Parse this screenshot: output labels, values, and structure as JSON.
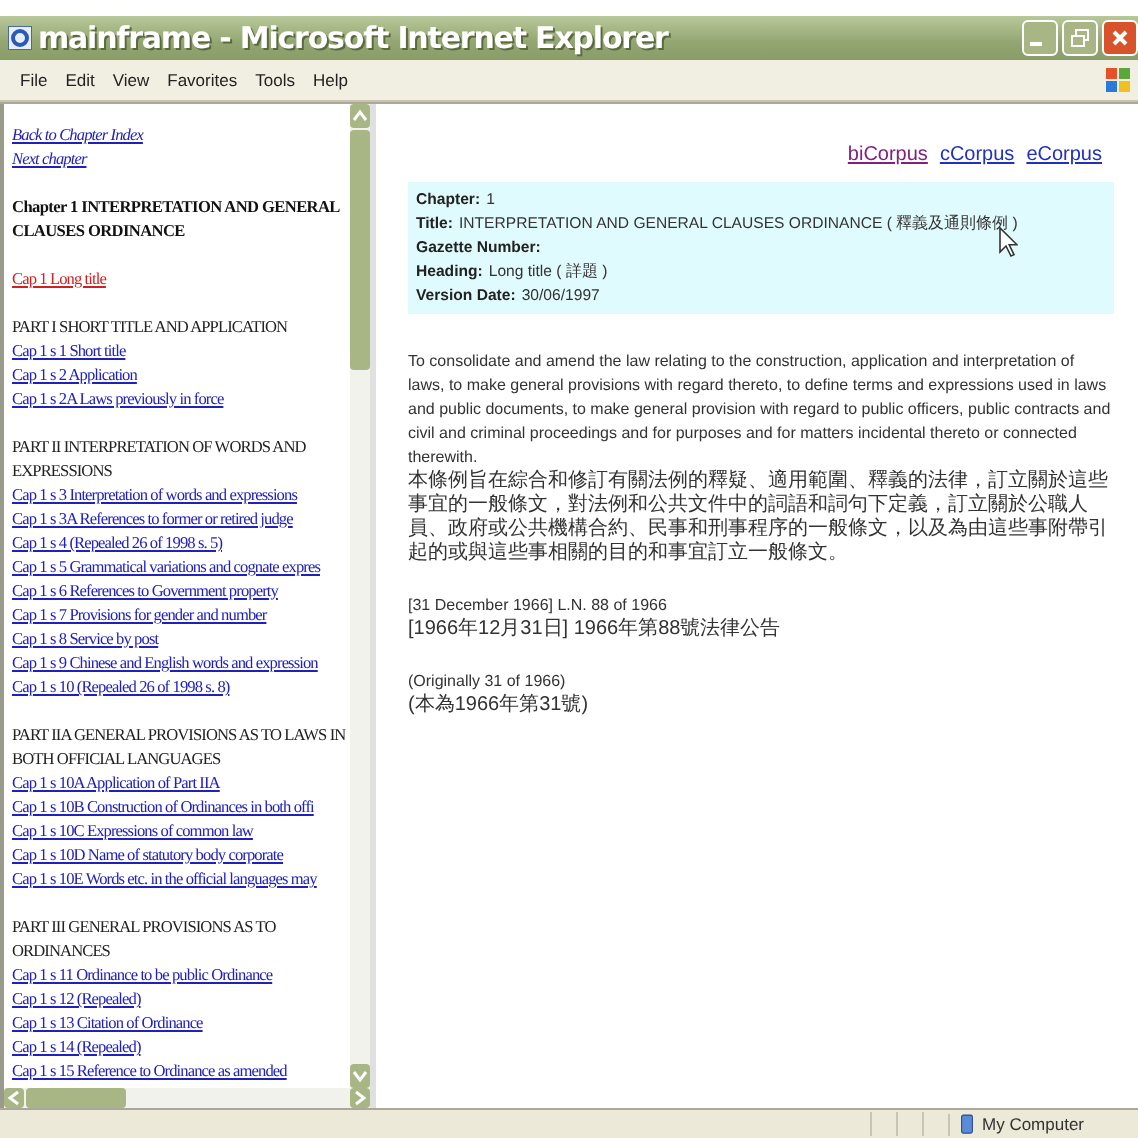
{
  "window": {
    "title": "mainframe - Microsoft Internet Explorer"
  },
  "menu": [
    "File",
    "Edit",
    "View",
    "Favorites",
    "Tools",
    "Help"
  ],
  "left_frame": {
    "nav_links": [
      "Back to Chapter Index",
      "Next chapter"
    ],
    "chapter_title": "Chapter 1 INTERPRETATION AND GENERAL CLAUSES ORDINANCE",
    "sections": [
      {
        "links": [
          {
            "text": "Cap 1 Long title",
            "selected": true
          }
        ]
      },
      {
        "heading": "PART I SHORT TITLE AND APPLICATION",
        "links": [
          {
            "text": "Cap 1 s 1 Short title",
            "selected": false
          },
          {
            "text": "Cap 1 s 2 Application",
            "selected": false
          },
          {
            "text": "Cap 1 s 2A Laws previously in force",
            "selected": false
          }
        ]
      },
      {
        "heading": "PART II INTERPRETATION OF WORDS AND EXPRESSIONS",
        "links": [
          {
            "text": "Cap 1 s 3 Interpretation of words and expressions",
            "selected": false
          },
          {
            "text": "Cap 1 s 3A References to former or retired judge",
            "selected": false
          },
          {
            "text": "Cap 1 s 4 (Repealed 26 of 1998 s. 5)",
            "selected": false
          },
          {
            "text": "Cap 1 s 5 Grammatical variations and cognate expres",
            "selected": false
          },
          {
            "text": "Cap 1 s 6 References to Government property",
            "selected": false
          },
          {
            "text": "Cap 1 s 7 Provisions for gender and number",
            "selected": false
          },
          {
            "text": "Cap 1 s 8 Service by post",
            "selected": false
          },
          {
            "text": "Cap 1 s 9 Chinese and English words and expression",
            "selected": false
          },
          {
            "text": "Cap 1 s 10 (Repealed 26 of 1998 s. 8)",
            "selected": false
          }
        ]
      },
      {
        "heading": "PART IIA GENERAL PROVISIONS AS TO LAWS IN BOTH OFFICIAL LANGUAGES",
        "links": [
          {
            "text": "Cap 1 s 10A Application of Part IIA",
            "selected": false
          },
          {
            "text": "Cap 1 s 10B Construction of Ordinances in both offi",
            "selected": false
          },
          {
            "text": "Cap 1 s 10C Expressions of common law",
            "selected": false
          },
          {
            "text": "Cap 1 s 10D Name of statutory body corporate",
            "selected": false
          },
          {
            "text": "Cap 1 s 10E Words etc. in the official languages may",
            "selected": false
          }
        ]
      },
      {
        "heading": "PART III GENERAL PROVISIONS AS TO ORDINANCES",
        "links": [
          {
            "text": "Cap 1 s 11 Ordinance to be public Ordinance",
            "selected": false
          },
          {
            "text": "Cap 1 s 12 (Repealed)",
            "selected": false
          },
          {
            "text": "Cap 1 s 13 Citation of Ordinance",
            "selected": false
          },
          {
            "text": "Cap 1 s 14 (Repealed)",
            "selected": false
          },
          {
            "text": "Cap 1 s 15 Reference to Ordinance as amended",
            "selected": false
          }
        ]
      }
    ]
  },
  "corpus_links": [
    {
      "text": "biCorpus",
      "visited": true
    },
    {
      "text": "cCorpus",
      "visited": false
    },
    {
      "text": "eCorpus",
      "visited": false
    }
  ],
  "info": [
    {
      "label": "Chapter:",
      "value": "1"
    },
    {
      "label": "Title:",
      "value": "INTERPRETATION AND GENERAL CLAUSES ORDINANCE ( 釋義及通則條例 )"
    },
    {
      "label": "Gazette Number:"
    },
    {
      "label": "Heading:",
      "value": "Long title ( 詳題 )"
    },
    {
      "label": "Version Date:",
      "value": "30/06/1997"
    }
  ],
  "body": [
    [
      "To consolidate and amend the law relating to the construction, application and interpretation of laws, to make general provisions with regard thereto, to define terms and expressions used in laws and public documents, to make general provision with regard to public officers, public contracts and civil and criminal proceedings and for purposes and for matters incidental thereto or connected therewith.",
      "本條例旨在綜合和修訂有關法例的釋疑、適用範圍、釋義的法律，訂立關於這些事宜的一般條文，對法例和公共文件中的詞語和詞句下定義，訂立關於公職人員、政府或公共機構合約、民事和刑事程序的一般條文，以及為由這些事附帶引起的或與這些事相關的目的和事宜訂立一般條文。"
    ],
    [
      "[31 December 1966] L.N. 88 of 1966",
      "[1966年12月31日] 1966年第88號法律公告"
    ],
    [
      "(Originally 31 of 1966)",
      "(本為1966年第31號)"
    ]
  ],
  "status_bar": {
    "zone": "My Computer"
  }
}
